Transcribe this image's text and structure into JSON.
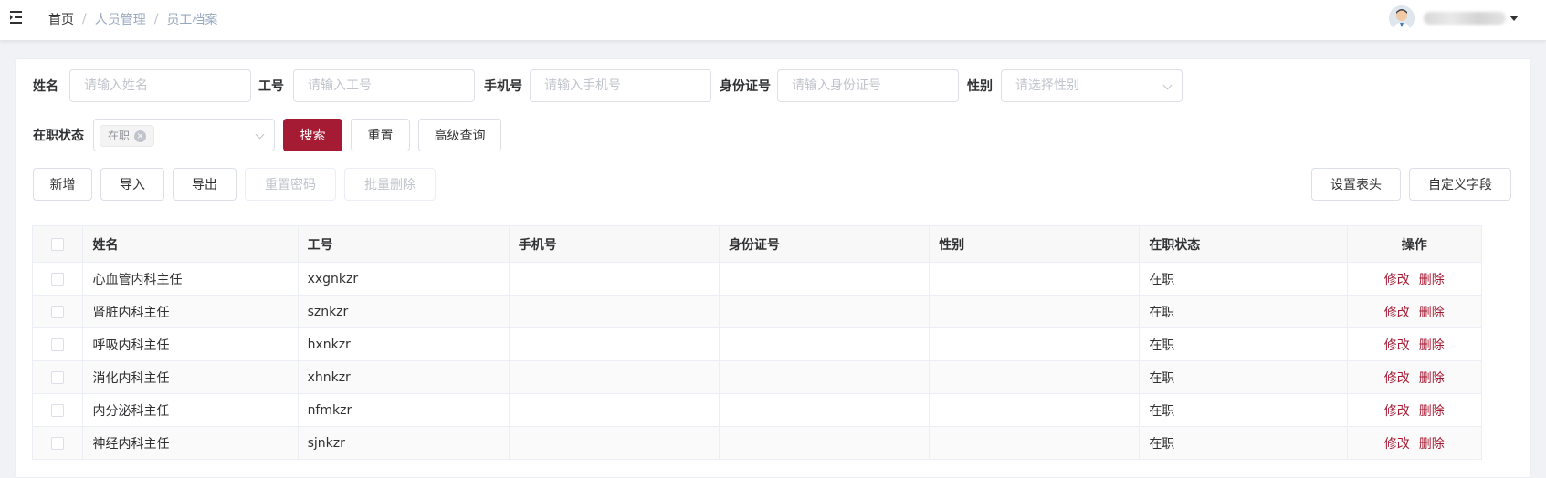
{
  "breadcrumb": {
    "home": "首页",
    "level2": "人员管理",
    "current": "员工档案"
  },
  "icons": {
    "menu": "hamburger-fold-icon",
    "dropdown": "caret-down-icon"
  },
  "accent_color": "#a61b34",
  "filters": {
    "name_label": "姓名",
    "name_placeholder": "请输入姓名",
    "jobno_label": "工号",
    "jobno_placeholder": "请输入工号",
    "phone_label": "手机号",
    "phone_placeholder": "请输入手机号",
    "idcard_label": "身份证号",
    "idcard_placeholder": "请输入身份证号",
    "gender_label": "性别",
    "gender_placeholder": "请选择性别",
    "status_label": "在职状态",
    "status_tag": "在职"
  },
  "actions": {
    "search": "搜索",
    "reset": "重置",
    "advanced": "高级查询"
  },
  "toolbar": {
    "add": "新增",
    "import": "导入",
    "export": "导出",
    "reset_password": "重置密码",
    "batch_delete": "批量删除",
    "set_header": "设置表头",
    "custom_field": "自定义字段"
  },
  "table": {
    "headers": {
      "name": "姓名",
      "jobno": "工号",
      "phone": "手机号",
      "idcard": "身份证号",
      "gender": "性别",
      "status": "在职状态",
      "ops": "操作"
    },
    "edit": "修改",
    "delete": "删除",
    "rows": [
      {
        "name": "心血管内科主任",
        "jobno": "xxgnkzr",
        "phone": "",
        "idcard": "",
        "gender": "",
        "status": "在职"
      },
      {
        "name": "肾脏内科主任",
        "jobno": "sznkzr",
        "phone": "",
        "idcard": "",
        "gender": "",
        "status": "在职"
      },
      {
        "name": "呼吸内科主任",
        "jobno": "hxnkzr",
        "phone": "",
        "idcard": "",
        "gender": "",
        "status": "在职"
      },
      {
        "name": "消化内科主任",
        "jobno": "xhnkzr",
        "phone": "",
        "idcard": "",
        "gender": "",
        "status": "在职"
      },
      {
        "name": "内分泌科主任",
        "jobno": "nfmkzr",
        "phone": "",
        "idcard": "",
        "gender": "",
        "status": "在职"
      },
      {
        "name": "神经内科主任",
        "jobno": "sjnkzr",
        "phone": "",
        "idcard": "",
        "gender": "",
        "status": "在职"
      }
    ]
  }
}
